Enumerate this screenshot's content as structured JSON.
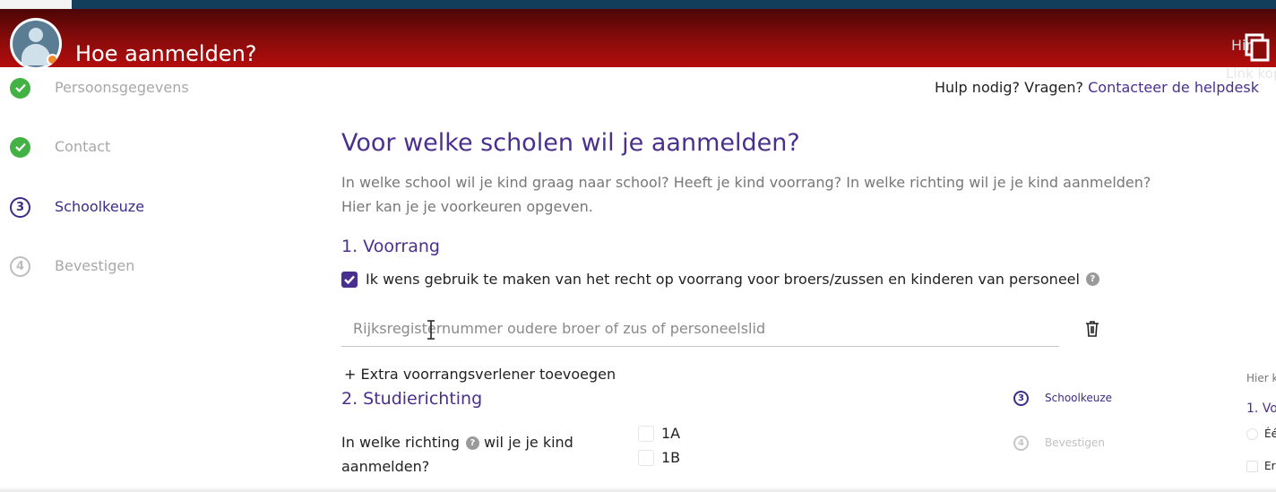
{
  "header": {
    "title": "Hoe aanmelden?",
    "hint_text": "Hint",
    "link_copy": "Link kopie",
    "gradient_colors": [
      "#4d0606",
      "#b40d0d"
    ]
  },
  "help": {
    "prefix": "Hulp nodig? Vragen?",
    "link": "Contacteer de helpdesk"
  },
  "steps": [
    {
      "label": "Persoonsgegevens",
      "status": "done",
      "number": ""
    },
    {
      "label": "Contact",
      "status": "done",
      "number": ""
    },
    {
      "label": "Schoolkeuze",
      "status": "active",
      "number": "3"
    },
    {
      "label": "Bevestigen",
      "status": "todo",
      "number": "4"
    }
  ],
  "main": {
    "title": "Voor welke scholen wil je aanmelden?",
    "intro": "In welke school wil je kind graag naar school? Heeft je kind voorrang? In welke richting wil je je kind aanmelden? Hier kan je je voorkeuren opgeven.",
    "section1": "1. Voorrang",
    "voorrang_checkbox": {
      "label": "Ik wens gebruik te maken van het recht op voorrang voor broers/zussen en kinderen van personeel",
      "checked": true
    },
    "rijksregister_placeholder": "Rijksregisternummer oudere broer of zus of personeelslid",
    "add_voorrang": "+ Extra voorrangsverlener toevoegen",
    "section2": "2. Studierichting",
    "richting_question_a": "In welke richting",
    "richting_question_b": "wil je je kind aanmelden?",
    "options": [
      "1A",
      "1B"
    ]
  },
  "mini_preview": {
    "steps": [
      {
        "number": "3",
        "label": "Schoolkeuze"
      },
      {
        "number": "4",
        "label": "Bevestigen"
      }
    ],
    "hint_text": "Hier k",
    "section": "1. Vo",
    "option1": "Éé",
    "option2": "Er"
  },
  "icons": {
    "done": "check-circle-icon",
    "help": "question-circle-icon",
    "delete": "trash-icon",
    "copy": "copy-icon",
    "cursor": "text-cursor-icon"
  },
  "colors": {
    "accent": "#4a2f8f",
    "done_green": "#43b245",
    "header_red": "#8b0b0b",
    "top_strip": "#123e5c"
  }
}
